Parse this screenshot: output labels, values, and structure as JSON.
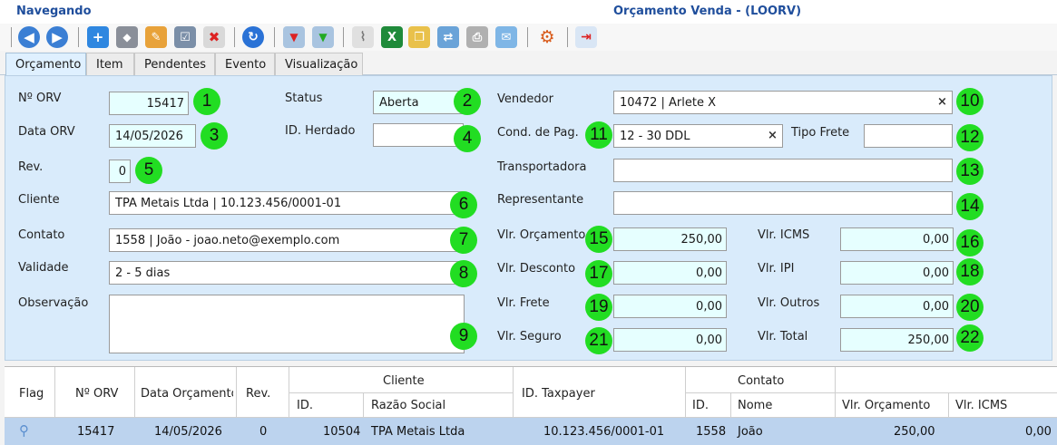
{
  "window": {
    "mode": "Navegando",
    "title": "Orçamento Venda - (LOORV)"
  },
  "toolbar": {
    "icons": [
      "back-icon",
      "forward-icon",
      "add-icon",
      "eraser-icon",
      "edit-icon",
      "checklist-icon",
      "delete-icon",
      "refresh-icon",
      "filter-remove-icon",
      "filter-add-icon",
      "attach-icon",
      "excel-icon",
      "copy-icon",
      "transfer-icon",
      "print-icon",
      "email-icon",
      "settings-icon",
      "exit-icon"
    ]
  },
  "tabs": [
    "Orçamento",
    "Item",
    "Pendentes",
    "Evento",
    "Visualização"
  ],
  "form": {
    "orv": {
      "label": "Nº ORV",
      "value": "15417",
      "badge": "1"
    },
    "status": {
      "label": "Status",
      "value": "Aberta",
      "badge": "2"
    },
    "data_orv": {
      "label": "Data ORV",
      "value": "14/05/2026",
      "badge": "3"
    },
    "id_herdado": {
      "label": "ID. Herdado",
      "value": "",
      "badge": "4"
    },
    "rev": {
      "label": "Rev.",
      "value": "0",
      "badge": "5"
    },
    "cliente": {
      "label": "Cliente",
      "value": "TPA Metais Ltda | 10.123.456/0001-01",
      "badge": "6"
    },
    "contato": {
      "label": "Contato",
      "value": "1558 | João - joao.neto@exemplo.com",
      "badge": "7"
    },
    "validade": {
      "label": "Validade",
      "value": "2 - 5 dias",
      "badge": "8"
    },
    "observacao": {
      "label": "Observação",
      "value": "",
      "badge": "9"
    },
    "vendedor": {
      "label": "Vendedor",
      "value": "10472 | Arlete X",
      "badge": "10"
    },
    "cond_pag": {
      "label": "Cond. de Pag.",
      "value": "12 - 30 DDL",
      "badge": "11"
    },
    "tipo_frete": {
      "label": "Tipo Frete",
      "value": "",
      "badge": "12"
    },
    "transportadora": {
      "label": "Transportadora",
      "value": "",
      "badge": "13"
    },
    "representante": {
      "label": "Representante",
      "value": "",
      "badge": "14"
    },
    "vlr_orcamento": {
      "label": "Vlr. Orçamento",
      "value": "250,00",
      "badge": "15"
    },
    "vlr_icms": {
      "label": "Vlr. ICMS",
      "value": "0,00",
      "badge": "16"
    },
    "vlr_desconto": {
      "label": "Vlr. Desconto",
      "value": "0,00",
      "badge": "17"
    },
    "vlr_ipi": {
      "label": "Vlr. IPI",
      "value": "0,00",
      "badge": "18"
    },
    "vlr_frete": {
      "label": "Vlr. Frete",
      "value": "0,00",
      "badge": "19"
    },
    "vlr_outros": {
      "label": "Vlr. Outros",
      "value": "0,00",
      "badge": "20"
    },
    "vlr_seguro": {
      "label": "Vlr. Seguro",
      "value": "0,00",
      "badge": "21"
    },
    "vlr_total": {
      "label": "Vlr. Total",
      "value": "250,00",
      "badge": "22"
    },
    "clear_symbol": "×"
  },
  "grid": {
    "headers": {
      "flag": "Flag",
      "orv": "Nº ORV",
      "data": "Data Orçamento",
      "rev": "Rev.",
      "cliente": "Cliente",
      "cliente_id": "ID.",
      "razao": "Razão Social",
      "taxpayer": "ID. Taxpayer",
      "contato": "Contato",
      "contato_id": "ID.",
      "nome": "Nome",
      "vlr_orc": "Vlr. Orçamento",
      "vlr_icms": "Vlr. ICMS"
    },
    "rows": [
      {
        "orv": "15417",
        "data": "14/05/2026",
        "rev": "0",
        "cliente_id": "10504",
        "razao": "TPA Metais Ltda",
        "taxpayer": "10.123.456/0001-01",
        "contato_id": "1558",
        "nome": "João",
        "vlr_orc": "250,00",
        "vlr_icms": "0,00"
      }
    ]
  }
}
